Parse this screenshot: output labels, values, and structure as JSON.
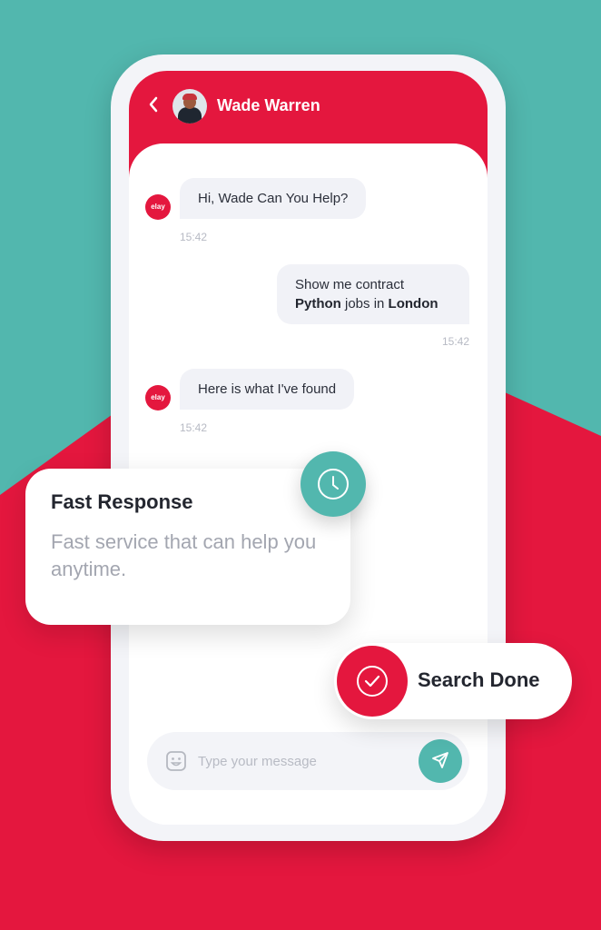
{
  "colors": {
    "brand_red": "#e4173e",
    "accent_teal": "#52b7ae",
    "bubble_bg": "#f1f2f7"
  },
  "header": {
    "back_icon": "chevron-left-icon",
    "contact_name": "Wade Warren",
    "avatar_icon": "user-avatar"
  },
  "messages": [
    {
      "sender": "bot",
      "avatar_label": "elay",
      "text": "Hi, Wade Can You Help?",
      "time": "15:42"
    },
    {
      "sender": "user",
      "text_line1": "Show me contract",
      "text_bold1": "Python",
      "text_mid": " jobs in ",
      "text_bold2": "London",
      "time": "15:42"
    },
    {
      "sender": "bot",
      "avatar_label": "elay",
      "text": "Here is what I've found",
      "time": "15:42"
    }
  ],
  "composer": {
    "placeholder": "Type your message",
    "value": "",
    "emoji_icon": "smiley-icon",
    "send_icon": "send-icon"
  },
  "feature_card": {
    "title": "Fast Response",
    "description": "Fast service that can help you anytime.",
    "icon": "clock-icon"
  },
  "status_pill": {
    "label": "Search Done",
    "icon": "check-circle-icon"
  }
}
